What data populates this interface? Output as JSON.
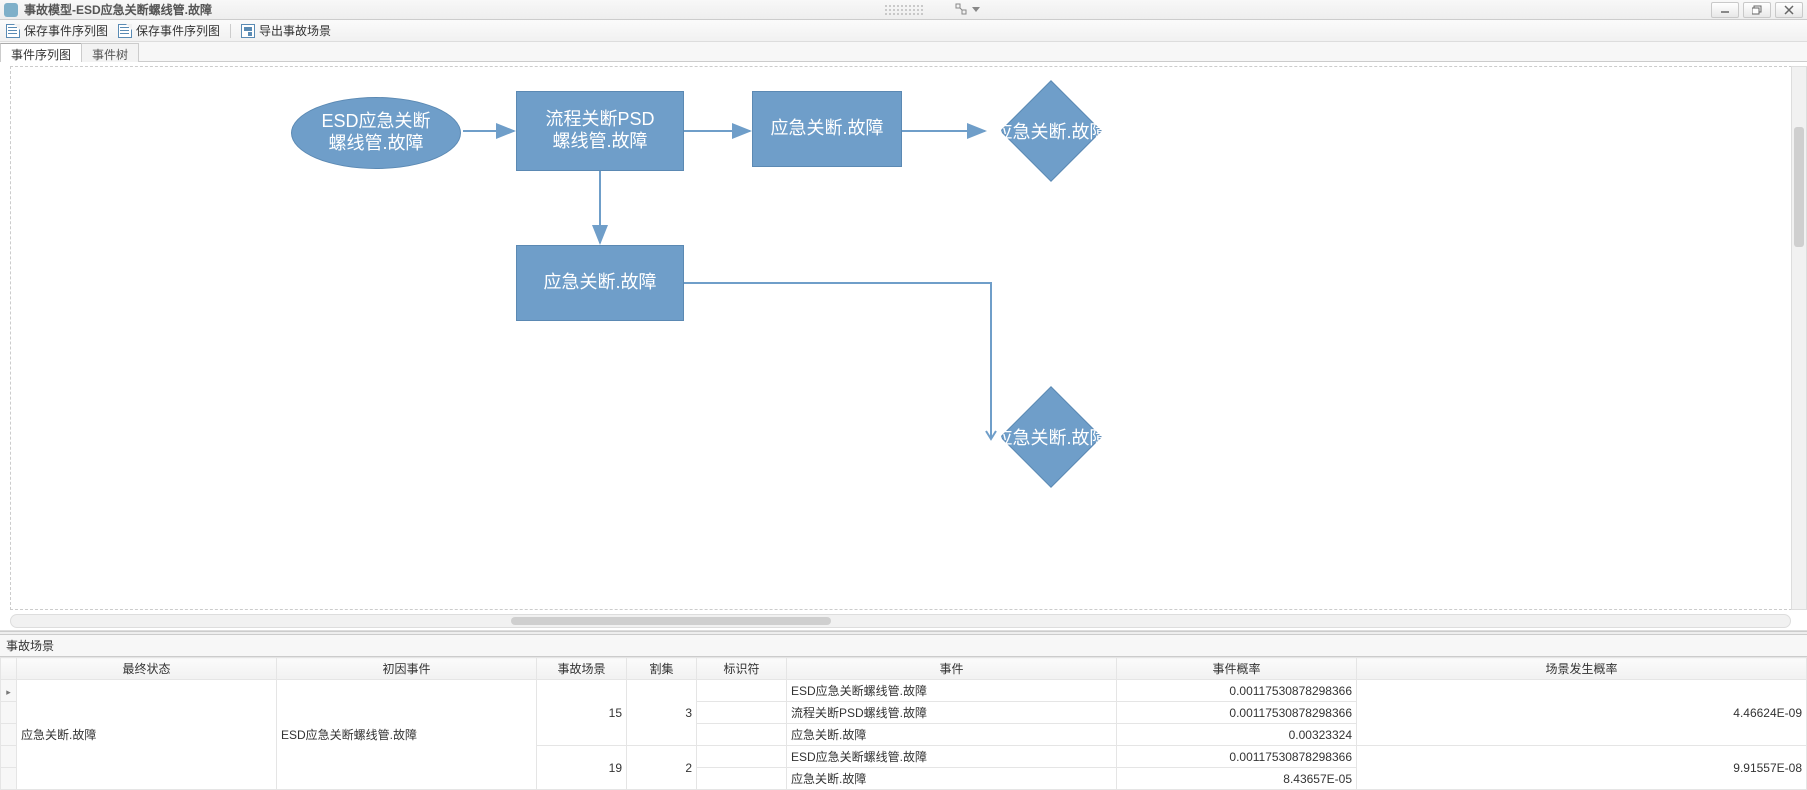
{
  "window": {
    "title": "事故模型-ESD应急关断螺线管.故障"
  },
  "toolbar": {
    "save_seq": "保存事件序列图",
    "save_seq_2": "保存事件序列图",
    "export_scene": "导出事故场景"
  },
  "tabs": {
    "t1": "事件序列图",
    "t2": "事件树"
  },
  "nodes": {
    "n1_l1": "ESD应急关断",
    "n1_l2": "螺线管.故障",
    "n2_l1": "流程关断PSD",
    "n2_l2": "螺线管.故障",
    "n3": "应急关断.故障",
    "n4": "应急关断.故障",
    "n5": "应急关断.故障",
    "n6": "应急关断.故障"
  },
  "lower": {
    "title": "事故场景"
  },
  "table": {
    "headers": {
      "h_final": "最终状态",
      "h_init": "初因事件",
      "h_scene": "事故场景",
      "h_cutset": "割集",
      "h_id": "标识符",
      "h_event": "事件",
      "h_eventprob": "事件概率",
      "h_sceneprob": "场景发生概率"
    },
    "rows": {
      "final1": "应急关断.故障",
      "init1": "ESD应急关断螺线管.故障",
      "scene_a": "15",
      "cutset_a": "3",
      "scene_b": "19",
      "cutset_b": "2",
      "ev1": "ESD应急关断螺线管.故障",
      "ev2": "流程关断PSD螺线管.故障",
      "ev3": "应急关断.故障",
      "ev4": "ESD应急关断螺线管.故障",
      "ev5": "应急关断.故障",
      "p1": "0.00117530878298366",
      "p2": "0.00117530878298366",
      "p3": "0.00323324",
      "p4": "0.00117530878298366",
      "p5": "8.43657E-05",
      "sp1": "4.46624E-09",
      "sp2": "9.91557E-08"
    }
  }
}
